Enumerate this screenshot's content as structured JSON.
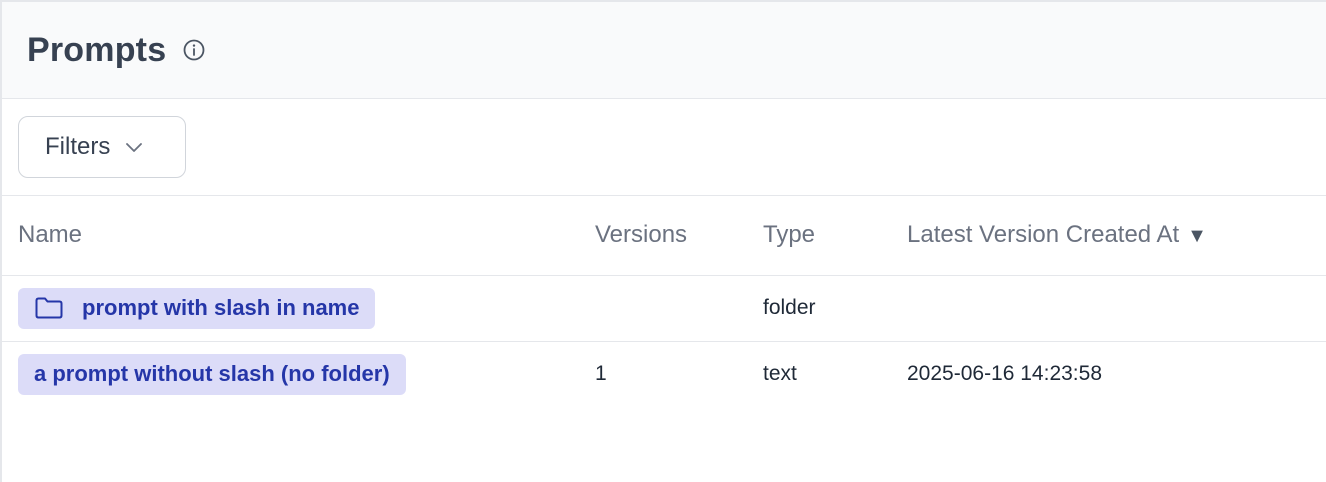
{
  "header": {
    "title": "Prompts",
    "info_icon": "info-icon"
  },
  "toolbar": {
    "filters_label": "Filters",
    "filters_icon": "chevron-down-icon"
  },
  "table": {
    "columns": {
      "name": "Name",
      "versions": "Versions",
      "type": "Type",
      "latest_created": "Latest Version Created At",
      "sort_indicator": "▼"
    },
    "rows": [
      {
        "name": "prompt with slash in name",
        "icon": "folder-icon",
        "versions": "",
        "type": "folder",
        "latest_created": ""
      },
      {
        "name": "a prompt without slash (no folder)",
        "icon": "",
        "versions": "1",
        "type": "text",
        "latest_created": "2025-06-16 14:23:58"
      }
    ]
  },
  "colors": {
    "chip_bg": "#dcdcf8",
    "chip_text": "#2536a8",
    "header_bg": "#f9fafb",
    "muted_text": "#6b7280"
  }
}
